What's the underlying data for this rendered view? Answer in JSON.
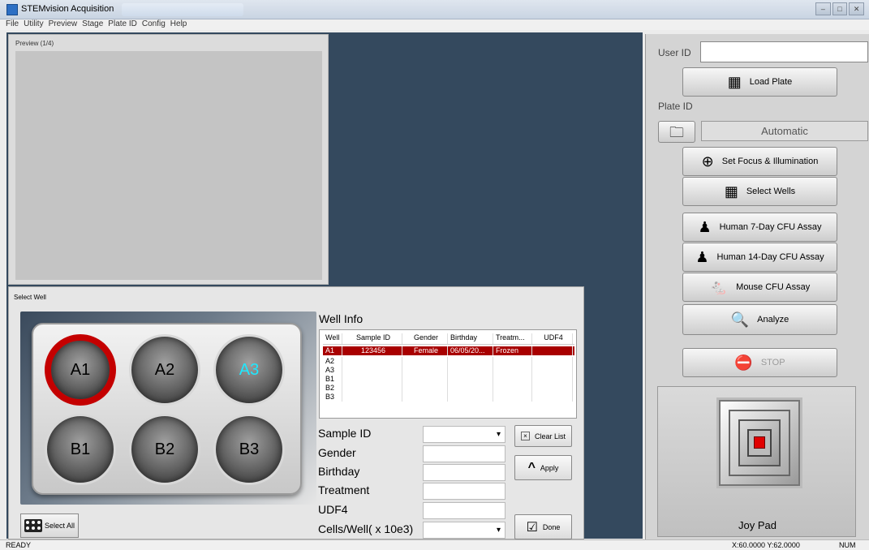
{
  "window": {
    "title": "STEMvision Acquisition",
    "controls": [
      "–",
      "□",
      "✕"
    ]
  },
  "menu": [
    "File",
    "Utility",
    "Preview",
    "Stage",
    "Plate ID",
    "Config",
    "Help"
  ],
  "preview": {
    "title": "Preview (1/4)"
  },
  "select_well": {
    "title": "Select Well",
    "wells": [
      {
        "id": "A1",
        "selected": true
      },
      {
        "id": "A2",
        "selected": false
      },
      {
        "id": "A3",
        "selected": false
      },
      {
        "id": "B1",
        "selected": false
      },
      {
        "id": "B2",
        "selected": false
      },
      {
        "id": "B3",
        "selected": false
      }
    ],
    "select_all_label": "Select All"
  },
  "well_info": {
    "label": "Well Info",
    "columns": [
      "Well",
      "Sample ID",
      "Gender",
      "Birthday",
      "Treatm...",
      "UDF4"
    ],
    "rows": [
      [
        "A1",
        "123456",
        "Female",
        "06/05/20...",
        "Frozen",
        ""
      ],
      [
        "A2",
        "",
        "",
        "",
        "",
        ""
      ],
      [
        "A3",
        "",
        "",
        "",
        "",
        ""
      ],
      [
        "B1",
        "",
        "",
        "",
        "",
        ""
      ],
      [
        "B2",
        "",
        "",
        "",
        "",
        ""
      ],
      [
        "B3",
        "",
        "",
        "",
        "",
        ""
      ]
    ],
    "fields": {
      "sample_id": "Sample ID",
      "gender": "Gender",
      "birthday": "Birthday",
      "treatment": "Treatment",
      "udf4": "UDF4",
      "cells_per_well": "Cells/Well( x 10e3)"
    },
    "dropdown_arrow": "▾",
    "clear_list": "Clear List",
    "apply": "Apply",
    "done": "Done"
  },
  "right_panel": {
    "user_id_label": "User ID",
    "user_id_value": "",
    "load_plate": "Load Plate",
    "plate_id_label": "Plate ID",
    "plate_id_value": "Automatic",
    "set_focus": "Set Focus & Illumination",
    "select_wells": "Select Wells",
    "human7": "Human 7-Day CFU Assay",
    "human14": "Human 14-Day CFU Assay",
    "mouse": "Mouse CFU Assay",
    "analyze": "Analyze",
    "stop": "STOP",
    "joy_pad": "Joy Pad"
  },
  "status": {
    "left": "READY",
    "coords": "X:60.0000  Y:62.0000",
    "num": "NUM"
  },
  "colors": {
    "workspace": "#34495e",
    "selected_row": "#a80000",
    "selected_well_ring": "#c40000",
    "highlight_text": "#1ee8ff"
  }
}
